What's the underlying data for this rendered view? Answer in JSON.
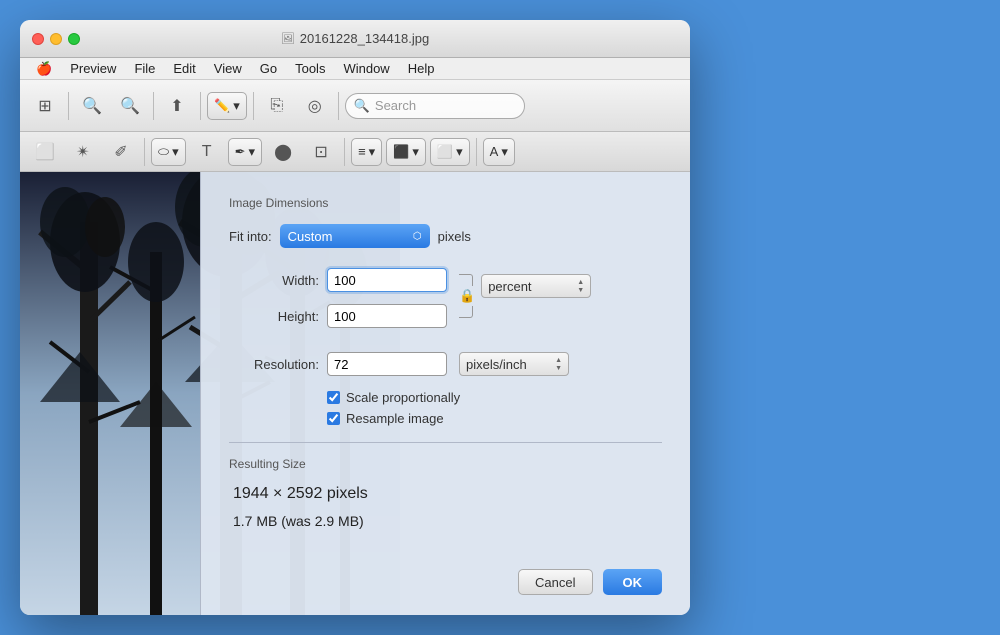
{
  "window": {
    "title": "20161228_134418.jpg",
    "title_icon": "🖼"
  },
  "menu": {
    "items": [
      "Preview",
      "File",
      "Edit",
      "View",
      "Go",
      "Tools",
      "Window",
      "Help"
    ]
  },
  "toolbar": {
    "search_placeholder": "Search"
  },
  "dialog": {
    "section_title": "Image Dimensions",
    "fit_label": "Fit into:",
    "fit_value": "Custom",
    "pixels_label": "pixels",
    "width_label": "Width:",
    "width_value": "100",
    "height_label": "Height:",
    "height_value": "100",
    "resolution_label": "Resolution:",
    "resolution_value": "72",
    "unit_percent": "percent",
    "unit_pixels_inch": "pixels/inch",
    "scale_label": "Scale proportionally",
    "resample_label": "Resample image",
    "resulting_title": "Resulting Size",
    "result_dimensions": "1944 × 2592 pixels",
    "result_filesize": "1.7 MB (was 2.9 MB)",
    "cancel_label": "Cancel",
    "ok_label": "OK"
  }
}
